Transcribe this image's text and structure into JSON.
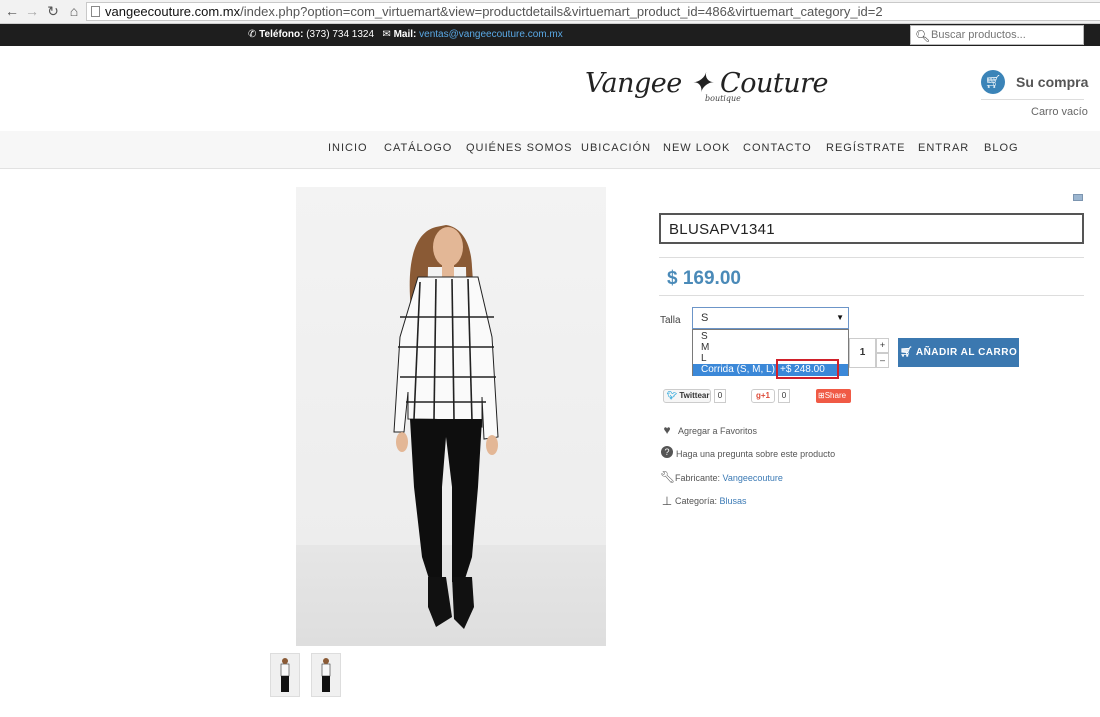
{
  "browser": {
    "url_host": "vangeecouture.com.mx",
    "url_rest": "/index.php?option=com_virtuemart&view=productdetails&virtuemart_product_id=486&virtuemart_category_id=2",
    "back_icon": "back-arrow-icon",
    "forward_icon": "forward-arrow-icon",
    "reload_icon": "reload-icon",
    "home_icon": "home-icon"
  },
  "topbar": {
    "phone_label": "Teléfono:",
    "phone": "(373) 734 1324",
    "mail_label": "Mail:",
    "mail": "ventas@vangeecouture.com.mx",
    "search_placeholder": "Buscar productos..."
  },
  "brand": {
    "logo_text": "Vangee ✦ Couture",
    "logo_sub": "boutique"
  },
  "cart": {
    "title": "Su compra",
    "status": "Carro vacío"
  },
  "menu": [
    "INICIO",
    "CATÁLOGO",
    "QUIÉNES SOMOS",
    "UBICACIÓN",
    "NEW LOOK",
    "CONTACTO",
    "REGÍSTRATE",
    "ENTRAR",
    "BLOG"
  ],
  "product": {
    "name": "BLUSAPV1341",
    "price": "$ 169.00",
    "talla_label": "Talla",
    "selected_size": "S",
    "options": [
      "S",
      "M",
      "L"
    ],
    "highlighted_option": "Corrida (S, M, L)",
    "highlighted_option_price": "+$ 248.00",
    "quantity": "1",
    "qty_plus": "+",
    "qty_minus": "–",
    "add_to_cart": "AÑADIR AL CARRO"
  },
  "social": {
    "twitter_label": "Twittear",
    "twitter_count": "0",
    "gplus_label": "+1",
    "gplus_count": "0",
    "share_label": "Share"
  },
  "links": {
    "favorites": "Agregar a Favoritos",
    "question": "Haga una pregunta sobre este producto",
    "manufacturer_label": "Fabricante:",
    "manufacturer": "Vangeecouture",
    "category_label": "Categoría:",
    "category": "Blusas"
  },
  "colors": {
    "accent": "#3b78b0",
    "price": "#4a8ab8",
    "highlight_border": "#d0202a",
    "topbar": "#1e1e1e"
  }
}
